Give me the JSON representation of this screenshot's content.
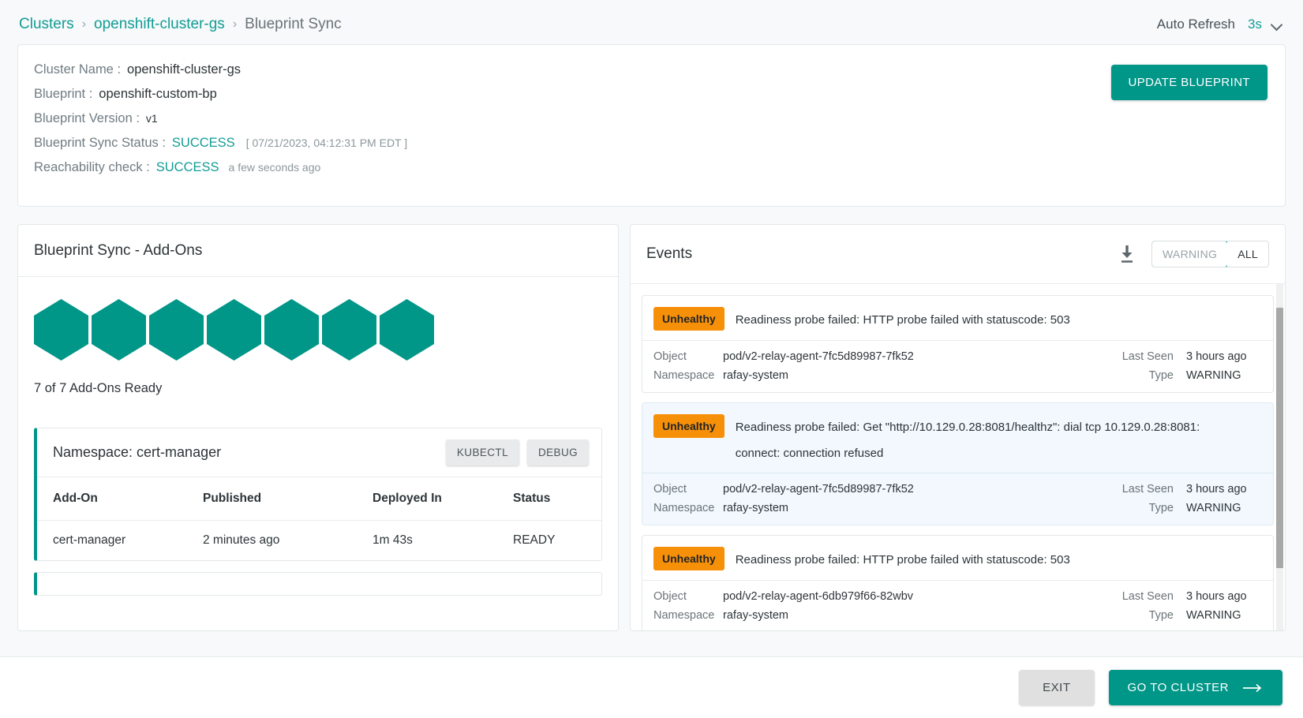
{
  "breadcrumb": {
    "items": [
      {
        "label": "Clusters",
        "type": "link"
      },
      {
        "label": "openshift-cluster-gs",
        "type": "link"
      },
      {
        "label": "Blueprint Sync",
        "type": "current"
      }
    ],
    "separator": "›"
  },
  "auto_refresh": {
    "label": "Auto Refresh",
    "value": "3s",
    "chevron_icon": "chevron-down-icon"
  },
  "cluster_info": {
    "rows": [
      {
        "label": "Cluster Name :",
        "value": "openshift-cluster-gs"
      },
      {
        "label": "Blueprint :",
        "value": "openshift-custom-bp"
      },
      {
        "label": "Blueprint Version :",
        "value": "v1"
      },
      {
        "label": "Blueprint Sync Status :",
        "value": "SUCCESS",
        "meta": "[ 07/21/2023, 04:12:31 PM EDT ]"
      },
      {
        "label": "Reachability check :",
        "value": "SUCCESS",
        "meta": "a few seconds ago"
      }
    ],
    "update_button": "UPDATE BLUEPRINT"
  },
  "addons_panel": {
    "title": "Blueprint Sync - Add-Ons",
    "hexagon_count": 7,
    "ready_text": "7 of 7 Add-Ons Ready",
    "namespace": {
      "title": "Namespace: cert-manager",
      "kubectl_label": "KUBECTL",
      "debug_label": "DEBUG"
    },
    "table": {
      "columns": [
        "Add-On",
        "Published",
        "Deployed In",
        "Status"
      ],
      "rows": [
        {
          "addon": "cert-manager",
          "published": "2 minutes ago",
          "deployed_in": "1m 43s",
          "status": "READY"
        }
      ]
    }
  },
  "events_panel": {
    "title": "Events",
    "download_icon": "download-icon",
    "filters": [
      {
        "label": "WARNING",
        "active": true
      },
      {
        "label": "ALL",
        "active": false
      }
    ],
    "meta_labels": {
      "object": "Object",
      "namespace": "Namespace",
      "last_seen": "Last Seen",
      "type": "Type"
    },
    "items": [
      {
        "badge": "Unhealthy",
        "message": "Readiness probe failed: HTTP probe failed with statuscode: 503",
        "message_cont": "",
        "object": "pod/v2-relay-agent-7fc5d89987-7fk52",
        "namespace": "rafay-system",
        "last_seen": "3 hours ago",
        "type": "WARNING",
        "highlight": false
      },
      {
        "badge": "Unhealthy",
        "message": "Readiness probe failed: Get \"http://10.129.0.28:8081/healthz\": dial tcp 10.129.0.28:8081:",
        "message_cont": "connect: connection refused",
        "object": "pod/v2-relay-agent-7fc5d89987-7fk52",
        "namespace": "rafay-system",
        "last_seen": "3 hours ago",
        "type": "WARNING",
        "highlight": true
      },
      {
        "badge": "Unhealthy",
        "message": "Readiness probe failed: HTTP probe failed with statuscode: 503",
        "message_cont": "",
        "object": "pod/v2-relay-agent-6db979f66-82wbv",
        "namespace": "rafay-system",
        "last_seen": "3 hours ago",
        "type": "WARNING",
        "highlight": false
      }
    ]
  },
  "footer": {
    "exit_label": "EXIT",
    "goto_label": "GO TO CLUSTER",
    "arrow_icon": "arrow-right-icon"
  },
  "colors": {
    "accent": "#009688",
    "link": "#129c95",
    "warning": "#f79009",
    "page_bg": "#f7f9fa"
  }
}
